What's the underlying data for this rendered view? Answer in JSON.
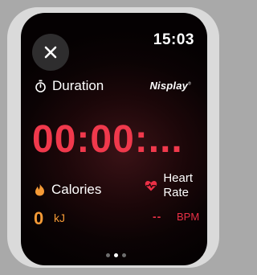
{
  "status_bar": {
    "time": "15:03"
  },
  "brand": {
    "name": "Nisplay",
    "mark": "®"
  },
  "duration": {
    "label": "Duration",
    "value": "00:00:...",
    "icon": "stopwatch-icon"
  },
  "calories": {
    "label": "Calories",
    "value": "0",
    "unit": "kJ",
    "icon": "flame-icon"
  },
  "heart_rate": {
    "label_line1": "Heart",
    "label_line2": "Rate",
    "value": "--",
    "unit": "BPM",
    "icon": "heartbeat-icon"
  },
  "controls": {
    "close_icon": "close-icon"
  },
  "pager": {
    "count": 3,
    "active_index": 1
  },
  "colors": {
    "timer": "#f0394c",
    "calories": "#f59a36",
    "heart_rate": "#ea3046"
  }
}
